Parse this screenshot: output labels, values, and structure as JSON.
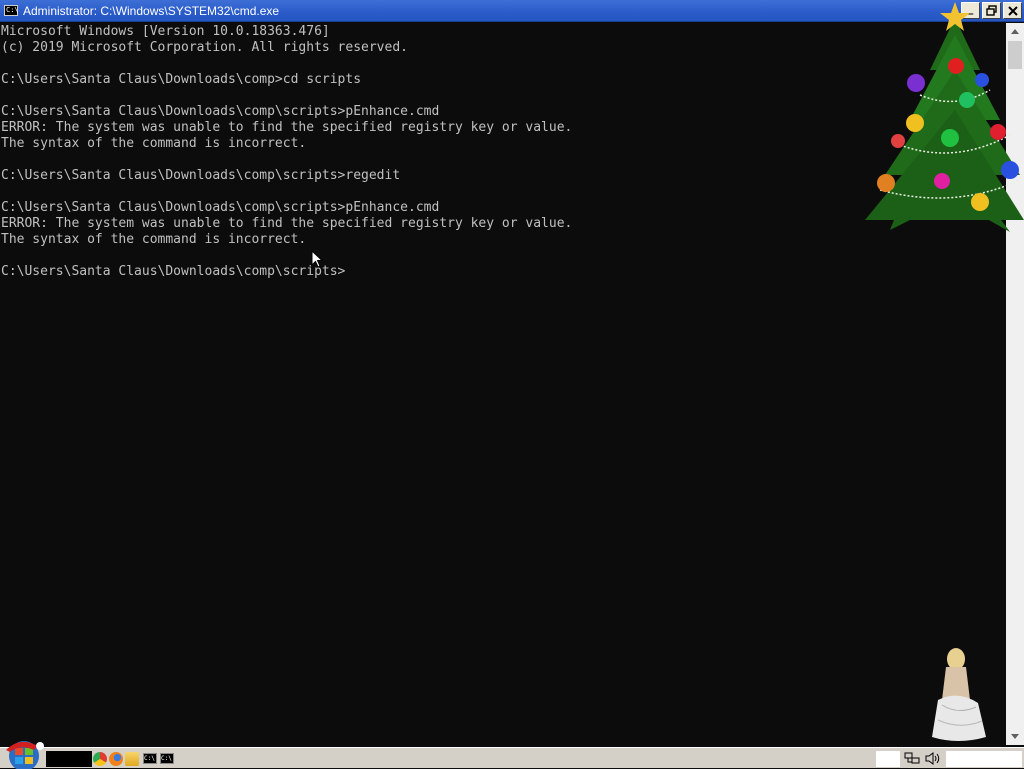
{
  "window": {
    "title": "Administrator: C:\\Windows\\SYSTEM32\\cmd.exe",
    "icon": "cmd-icon",
    "buttons": {
      "minimize": "_",
      "restore": "🗗",
      "close": "✕"
    }
  },
  "console": {
    "lines": [
      "Microsoft Windows [Version 10.0.18363.476]",
      "(c) 2019 Microsoft Corporation. All rights reserved.",
      "",
      "C:\\Users\\Santa Claus\\Downloads\\comp>cd scripts",
      "",
      "C:\\Users\\Santa Claus\\Downloads\\comp\\scripts>pEnhance.cmd",
      "ERROR: The system was unable to find the specified registry key or value.",
      "The syntax of the command is incorrect.",
      "",
      "C:\\Users\\Santa Claus\\Downloads\\comp\\scripts>regedit",
      "",
      "C:\\Users\\Santa Claus\\Downloads\\comp\\scripts>pEnhance.cmd",
      "ERROR: The system was unable to find the specified registry key or value.",
      "The syntax of the command is incorrect.",
      "",
      "C:\\Users\\Santa Claus\\Downloads\\comp\\scripts>"
    ],
    "text_color": "#c0c0c0",
    "background": "#0c0c0c"
  },
  "taskbar": {
    "quick_launch": [
      "chrome-icon",
      "firefox-icon",
      "file-explorer-icon",
      "cmd-icon",
      "cmd-icon"
    ],
    "tray": [
      "network-icon",
      "volume-icon"
    ]
  },
  "desktop_decorations": [
    "christmas-tree",
    "figurine"
  ]
}
